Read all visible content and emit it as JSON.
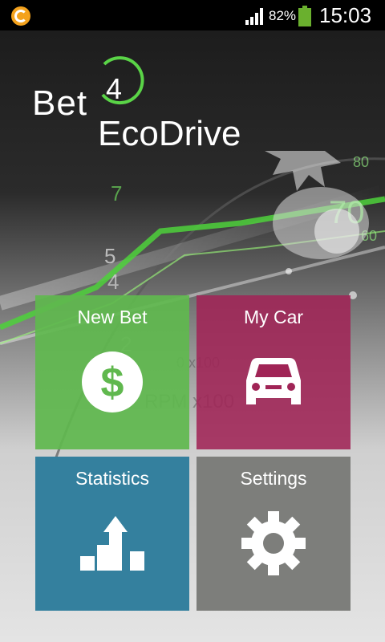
{
  "status_bar": {
    "battery_percent": "82%",
    "time": "15:03",
    "icons": [
      "notification-icon",
      "signal-icon",
      "battery-icon"
    ]
  },
  "app": {
    "logo": {
      "word1": "Bet",
      "number": "4",
      "word2": "EcoDrive"
    }
  },
  "tiles": [
    {
      "id": "new-bet",
      "label": "New Bet",
      "icon": "dollar-icon",
      "color": "#60b84e"
    },
    {
      "id": "my-car",
      "label": "My Car",
      "icon": "car-icon",
      "color": "#a02456"
    },
    {
      "id": "statistics",
      "label": "Statistics",
      "icon": "bar-chart-up-icon",
      "color": "#34809e"
    },
    {
      "id": "settings",
      "label": "Settings",
      "icon": "gear-icon",
      "color": "#7d7e7b"
    }
  ]
}
